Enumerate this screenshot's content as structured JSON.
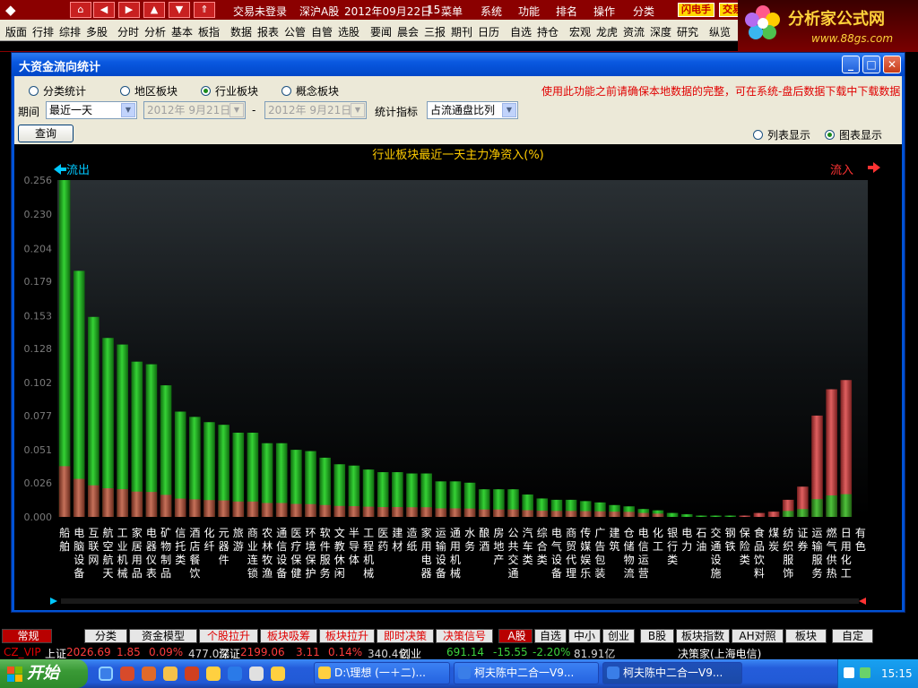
{
  "topbar": {
    "menus": [
      "交易未登录",
      "深沪A股",
      "2012年09月22日",
      "15",
      "菜单",
      "系统",
      "功能",
      "排名",
      "操作",
      "分类"
    ],
    "flash_label": "闪电手",
    "flash_label2": "交易"
  },
  "toolbar": {
    "items": [
      "版面",
      "行排",
      "综排",
      "多股",
      "分时",
      "分析",
      "基本",
      "板指",
      "数据",
      "报表",
      "公管",
      "自管",
      "选股",
      "要闻",
      "晨会",
      "三报",
      "期刊",
      "日历",
      "自选",
      "持仓",
      "宏观",
      "龙虎",
      "资流",
      "深度",
      "研究",
      "纵览"
    ]
  },
  "logo": {
    "title": "分析家公式网",
    "url": "www.88gs.com"
  },
  "dialog": {
    "title": "大资金流向统计",
    "radio_group": {
      "options": [
        "分类统计",
        "地区板块",
        "行业板块",
        "概念板块"
      ],
      "selected": 2
    },
    "period_label": "期间",
    "period_value": "最近一天",
    "date_from": "2012年 9月21日",
    "date_sep": "-",
    "date_to": "2012年 9月21日",
    "indicator_label": "统计指标",
    "indicator_value": "占流通盘比列",
    "warning": "使用此功能之前请确保本地数据的完整，可在系统-盘后数据下载中下载数据",
    "query_button": "查询",
    "display_options": [
      "列表显示",
      "图表显示"
    ],
    "display_selected": 1
  },
  "chart_data": {
    "type": "bar",
    "title": "行业板块最近一天主力净资入(%)",
    "outflow_label": "流出",
    "inflow_label": "流入",
    "y_ticks": [
      "0.256",
      "0.230",
      "0.204",
      "0.179",
      "0.153",
      "0.128",
      "0.102",
      "0.077",
      "0.051",
      "0.026",
      "0.000"
    ],
    "ylim": [
      0,
      0.256
    ],
    "categories": [
      "船舶",
      "电脑设备",
      "互联网",
      "航空航天",
      "工业机械",
      "家居用品",
      "电器仪表",
      "矿物制品",
      "信托类",
      "酒店餐饮",
      "化纤",
      "元器件",
      "旅游",
      "商业连锁",
      "农林牧渔",
      "通信设备",
      "医疗保健",
      "环境保护",
      "软件服务",
      "文教休闲",
      "半导体",
      "工程机械",
      "医药",
      "建材",
      "造纸",
      "家用电器",
      "运输设备",
      "通用机械",
      "水务",
      "酿酒",
      "房地产",
      "公共交通",
      "汽车类",
      "综合类",
      "电气设备",
      "商贸代理",
      "传媒娱乐",
      "广告包装",
      "建筑",
      "仓储物流",
      "电信运营",
      "化工",
      "银行类",
      "电力",
      "石油",
      "交通设施",
      "钢铁",
      "保险类",
      "食品饮料",
      "煤炭",
      "纺织服饰",
      "证券",
      "运输服务",
      "燃气供热",
      "日用化工",
      "有色"
    ],
    "series": [
      {
        "side": "outflow",
        "values": [
          0.256,
          0.187,
          0.152,
          0.136,
          0.131,
          0.118,
          0.116,
          0.1,
          0.08,
          0.076,
          0.072,
          0.07,
          0.064,
          0.064,
          0.056,
          0.056,
          0.051,
          0.05,
          0.045,
          0.04,
          0.039,
          0.036,
          0.034,
          0.034,
          0.033,
          0.033,
          0.027,
          0.027,
          0.026,
          0.021,
          0.021,
          0.021,
          0.017,
          0.014,
          0.013,
          0.013,
          0.012,
          0.011,
          0.009,
          0.008,
          0.006,
          0.005,
          0.003,
          0.002,
          0.001,
          0.001,
          0.001
        ]
      },
      {
        "side": "inflow",
        "values": [
          0.001,
          0.003,
          0.004,
          0.013,
          0.023,
          0.077,
          0.097,
          0.104
        ]
      }
    ],
    "colors": {
      "outflow": "#19a819",
      "inflow": "#c03c3c",
      "axis_label": "#7a7a7a",
      "category": "#ffffff",
      "title": "#ffcc00",
      "outflow_arrow": "#00c8ff",
      "inflow_arrow": "#ff3333"
    }
  },
  "bottom_tabs": {
    "items": [
      "常规",
      "分类",
      "资金模型",
      "个股拉升",
      "板块吸筹",
      "板块拉升",
      "即时决策",
      "决策信号",
      "A股",
      "自选",
      "中小",
      "创业",
      "B股",
      "板块指数",
      "AH对照",
      "板块",
      "自定"
    ]
  },
  "status": {
    "product": "CZ_VIP",
    "sh_label": "上证",
    "sh_index": "2026.69",
    "sh_change": "1.85",
    "sh_pct": "0.09%",
    "sh_amount": "477.0亿",
    "sz_label": "深证",
    "sz_index": "2199.06",
    "sz_change": "3.11",
    "sz_pct": "0.14%",
    "sz_amount": "340.4亿",
    "cy_label": "创业",
    "cy_index": "691.14",
    "cy_change": "-15.55",
    "cy_pct": "-2.20%",
    "cy_amount": "81.91亿",
    "vendor": "决策家(上海电信)"
  },
  "taskbar": {
    "start": "开始",
    "tasks": [
      "D:\\理想 (一＋二)...",
      "柯夫陈中二合一V9...",
      "柯夫陈中二合一V9..."
    ],
    "clock": "15:15"
  }
}
